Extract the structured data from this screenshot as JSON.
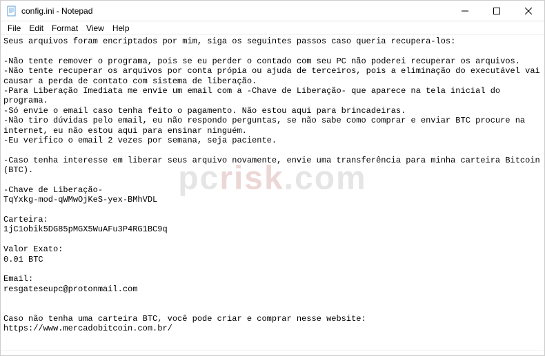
{
  "window": {
    "title": "config.ini - Notepad"
  },
  "menu": {
    "file": "File",
    "edit": "Edit",
    "format": "Format",
    "view": "View",
    "help": "Help"
  },
  "content": {
    "text": "Seus arquivos foram encriptados por mim, siga os seguintes passos caso queria recupera-los:\n\n-Não tente remover o programa, pois se eu perder o contado com seu PC não poderei recuperar os arquivos.\n-Não tente recuperar os arquivos por conta própia ou ajuda de terceiros, pois a eliminação do executável vai causar a perda de contato com sistema de liberação.\n-Para Liberação Imediata me envie um email com a -Chave de Liberação- que aparece na tela inicial do programa.\n-Só envie o email caso tenha feito o pagamento. Não estou aqui para brincadeiras.\n-Não tiro dúvidas pelo email, eu não respondo perguntas, se não sabe como comprar e enviar BTC procure na internet, eu não estou aqui para ensinar ninguém.\n-Eu verifico o email 2 vezes por semana, seja paciente.\n\n-Caso tenha interesse em liberar seus arquivo novamente, envie uma transferência para minha carteira Bitcoin (BTC).\n\n-Chave de Liberação-\nTqYxkg-mod-qWMwOjKeS-yex-BMhVDL\n\nCarteira:\n1jC1obik5DG85pMGX5WuAFu3P4RG1BC9q\n\nValor Exato:\n0.01 BTC\n\nEmail:\nresgateseupc@protonmail.com\n\n\nCaso não tenha uma carteira BTC, você pode criar e comprar nesse website:\nhttps://www.mercadobitcoin.com.br/"
  },
  "watermark": {
    "prefix": "pc",
    "suffix": "risk",
    "domain": ".com"
  }
}
